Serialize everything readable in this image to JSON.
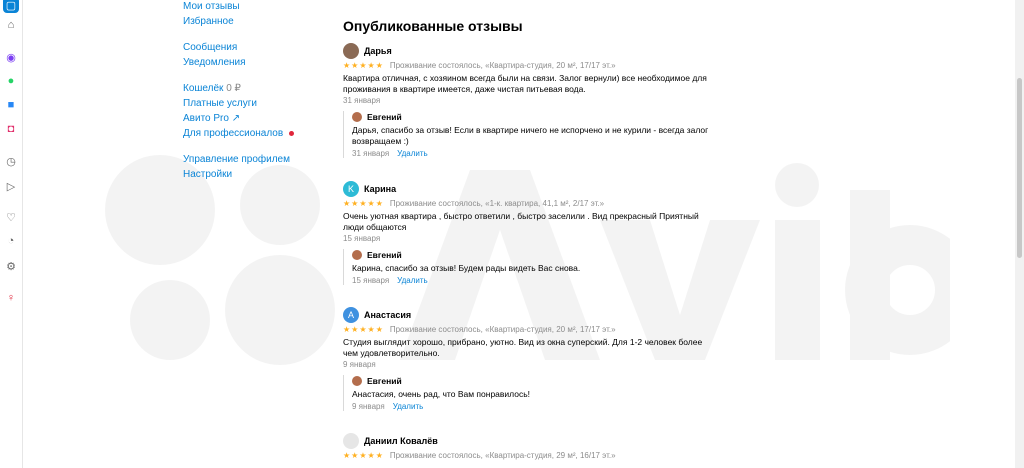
{
  "menu": {
    "items": [
      {
        "label": "Мои отзывы"
      },
      {
        "label": "Избранное"
      },
      {
        "label": "Сообщения"
      },
      {
        "label": "Уведомления"
      },
      {
        "label": "Кошелёк"
      },
      {
        "label": "Платные услуги"
      },
      {
        "label": "Авито Pro ↗"
      },
      {
        "label": "Для профессионалов"
      },
      {
        "label": "Управление профилем"
      },
      {
        "label": "Настройки"
      }
    ],
    "wallet_value": "0 ₽"
  },
  "page_title": "Опубликованные отзывы",
  "reviews": [
    {
      "name": "Дарья",
      "stars": "★★★★★",
      "deal": "Проживание состоялось, «Квартира-студия, 20 м², 17/17 эт.»",
      "text": "Квартира отличная, с хозяином всегда были на связи. Залог вернули) все необходимое для проживания в квартире имеется, даже чистая питьевая вода.",
      "date": "31 января",
      "reply": {
        "name": "Евгений",
        "text": "Дарья, спасибо за отзыв! Если в квартире ничего не испорчено и не курили - всегда залог возвращаем :)",
        "date": "31 января",
        "delete": "Удалить"
      }
    },
    {
      "name": "Карина",
      "avatar_letter": "K",
      "stars": "★★★★★",
      "deal": "Проживание состоялось, «1-к. квартира, 41,1 м², 2/17 эт.»",
      "text": "Очень уютная квартира , быстро ответили , быстро заселили . Вид прекрасный Приятный люди общаются",
      "date": "15 января",
      "reply": {
        "name": "Евгений",
        "text": "Карина, спасибо за отзыв! Будем рады видеть Вас снова.",
        "date": "15 января",
        "delete": "Удалить"
      }
    },
    {
      "name": "Анастасия",
      "avatar_letter": "А",
      "stars": "★★★★★",
      "deal": "Проживание состоялось, «Квартира-студия, 20 м², 17/17 эт.»",
      "text": "Студия выглядит хорошо, прибрано, уютно. Вид из окна суперский. Для 1-2 человек более чем удовлетворительно.",
      "date": "9 января",
      "reply": {
        "name": "Евгений",
        "text": "Анастасия, очень рад, что Вам понравилось!",
        "date": "9 января",
        "delete": "Удалить"
      }
    },
    {
      "name": "Даниил Ковалёв",
      "stars": "★★★★★",
      "deal": "Проживание состоялось, «Квартира-студия, 29 м², 16/17 эт.»"
    }
  ],
  "colors": {
    "link": "#0a84d6",
    "stars": "#ffb021",
    "karina_avatar": "#2dbbd6",
    "anastasia_avatar": "#3f91e0"
  }
}
